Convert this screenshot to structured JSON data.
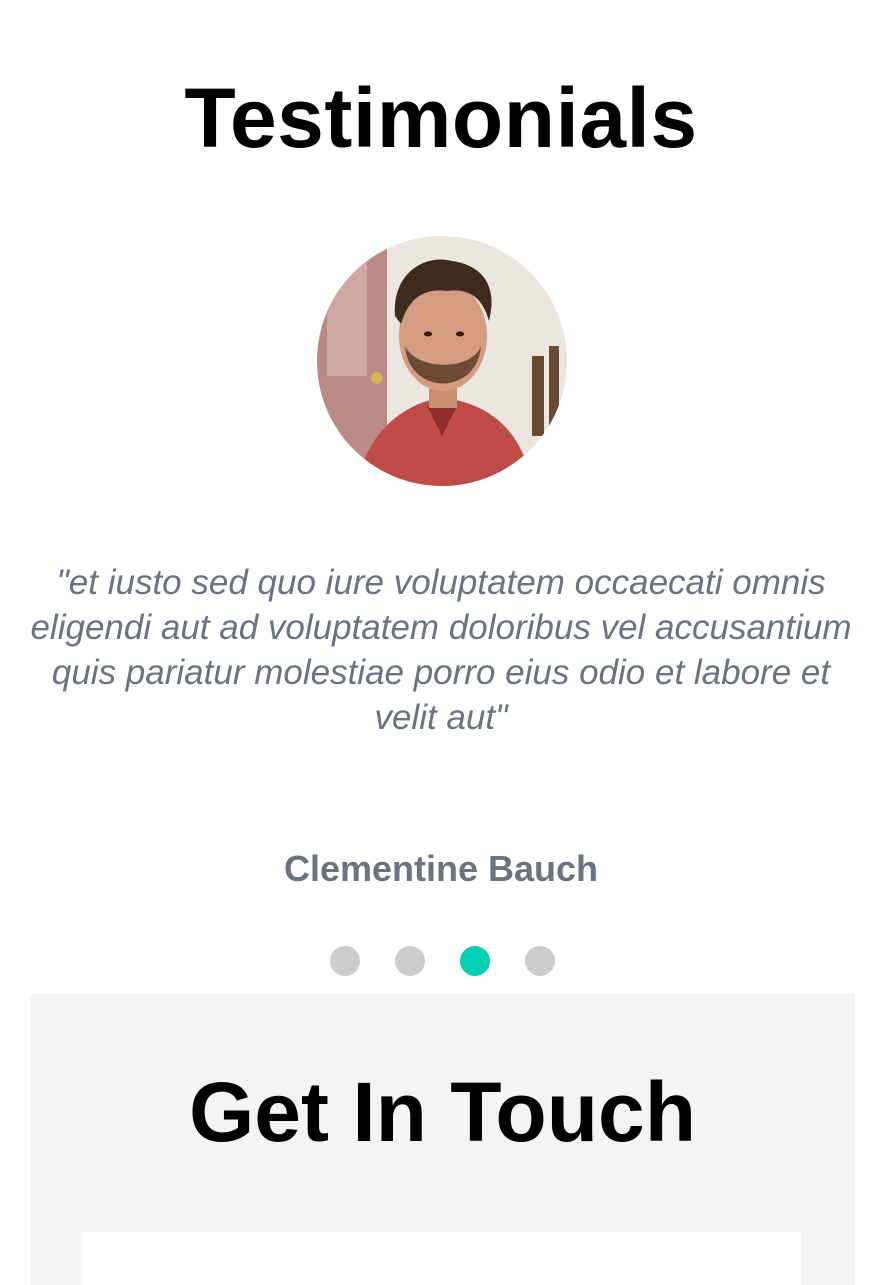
{
  "testimonials": {
    "title": "Testimonials",
    "avatar_icon": "person-photo",
    "quote": "\"et iusto sed quo iure voluptatem occaecati omnis eligendi aut ad voluptatem doloribus vel accusantium quis pariatur molestiae porro eius odio et labore et velit aut\"",
    "author": "Clementine Bauch",
    "slider": {
      "total": 4,
      "active_index": 2,
      "active_color": "#00cfb4",
      "inactive_color": "#cccccc"
    }
  },
  "contact": {
    "title": "Get In Touch",
    "background_color": "#f4f4f4"
  }
}
